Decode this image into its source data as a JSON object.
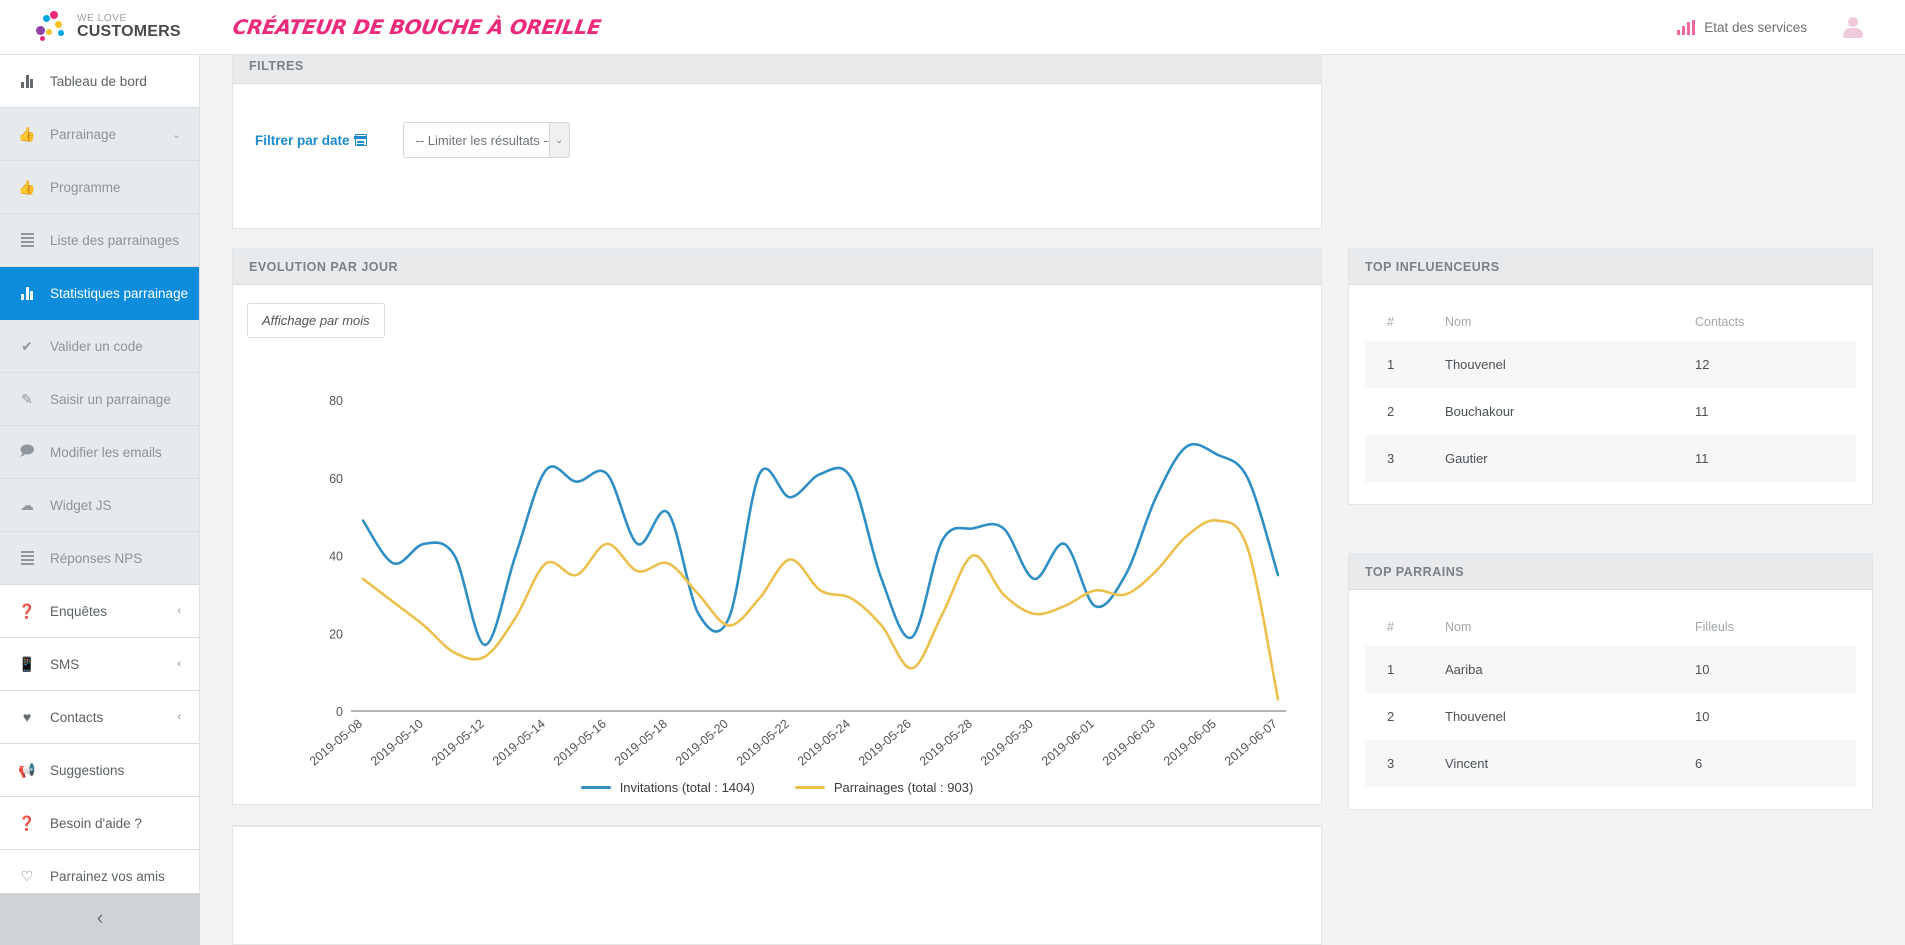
{
  "header": {
    "logo_line1": "WE LOVE",
    "logo_line2": "CUSTOMERS",
    "tagline": "CRÉATEUR DE BOUCHE À OREILLE",
    "services_label": "Etat des services",
    "services_icon": "signal-bars-icon",
    "avatar_icon": "user-avatar-icon",
    "brand_color": "#ec2a7b"
  },
  "sidebar": {
    "collapse_label": "‹",
    "items": [
      {
        "label": "Tableau de bord",
        "icon": "bar-chart-icon",
        "style": "white",
        "caret": ""
      },
      {
        "label": "Parrainage",
        "icon": "thumbs-up-icon",
        "style": "grey",
        "caret": "⌄"
      },
      {
        "label": "Programme",
        "icon": "thumbs-up-icon",
        "style": "grey",
        "caret": ""
      },
      {
        "label": "Liste des parrainages",
        "icon": "list-icon",
        "style": "grey",
        "caret": ""
      },
      {
        "label": "Statistiques parrainage",
        "icon": "bar-chart-icon",
        "style": "active",
        "caret": ""
      },
      {
        "label": "Valider un code",
        "icon": "check-icon",
        "style": "grey",
        "caret": ""
      },
      {
        "label": "Saisir un parrainage",
        "icon": "pencil-icon",
        "style": "grey",
        "caret": ""
      },
      {
        "label": "Modifier les emails",
        "icon": "comment-icon",
        "style": "grey",
        "caret": ""
      },
      {
        "label": "Widget JS",
        "icon": "cloud-icon",
        "style": "grey",
        "caret": ""
      },
      {
        "label": "Réponses NPS",
        "icon": "list-icon",
        "style": "grey",
        "caret": ""
      },
      {
        "label": "Enquêtes",
        "icon": "question-circle-icon",
        "style": "white",
        "caret": "‹"
      },
      {
        "label": "SMS",
        "icon": "mobile-icon",
        "style": "white",
        "caret": "‹"
      },
      {
        "label": "Contacts",
        "icon": "heart-icon",
        "style": "white",
        "caret": "‹"
      },
      {
        "label": "Suggestions",
        "icon": "megaphone-icon",
        "style": "white",
        "caret": ""
      },
      {
        "label": "Besoin d'aide ?",
        "icon": "question-circle-icon",
        "style": "white",
        "caret": ""
      },
      {
        "label": "Parrainez vos amis",
        "icon": "heart-outline-icon",
        "style": "white",
        "caret": ""
      }
    ]
  },
  "filters": {
    "title": "FILTRES",
    "date_filter_label": "Filtrer par date",
    "date_filter_icon": "calendar-icon",
    "limit_select_value": "-- Limiter les résultats --",
    "limit_select_arrow": "⌄"
  },
  "chart_panel": {
    "title": "EVOLUTION PAR JOUR",
    "month_toggle_label": "Affichage par mois"
  },
  "top_influenceurs": {
    "title": "TOP INFLUENCEURS",
    "columns": [
      "#",
      "Nom",
      "Contacts"
    ],
    "rows": [
      {
        "rank": "1",
        "name": "Thouvenel",
        "value": "12"
      },
      {
        "rank": "2",
        "name": "Bouchakour",
        "value": "11"
      },
      {
        "rank": "3",
        "name": "Gautier",
        "value": "11"
      }
    ]
  },
  "top_parrains": {
    "title": "TOP PARRAINS",
    "columns": [
      "#",
      "Nom",
      "Filleuls"
    ],
    "rows": [
      {
        "rank": "1",
        "name": "Aariba",
        "value": "10"
      },
      {
        "rank": "2",
        "name": "Thouvenel",
        "value": "10"
      },
      {
        "rank": "3",
        "name": "Vincent",
        "value": "6"
      }
    ]
  },
  "chart_data": {
    "type": "line",
    "title": "EVOLUTION PAR JOUR",
    "xlabel": "",
    "ylabel": "",
    "ylim": [
      0,
      88
    ],
    "yticks": [
      0,
      20,
      40,
      60,
      80
    ],
    "grid": false,
    "legend_position": "bottom",
    "x": [
      "2019-05-08",
      "2019-05-09",
      "2019-05-10",
      "2019-05-11",
      "2019-05-12",
      "2019-05-13",
      "2019-05-14",
      "2019-05-15",
      "2019-05-16",
      "2019-05-17",
      "2019-05-18",
      "2019-05-19",
      "2019-05-20",
      "2019-05-21",
      "2019-05-22",
      "2019-05-23",
      "2019-05-24",
      "2019-05-25",
      "2019-05-26",
      "2019-05-27",
      "2019-05-28",
      "2019-05-29",
      "2019-05-30",
      "2019-05-31",
      "2019-06-01",
      "2019-06-02",
      "2019-06-03",
      "2019-06-04",
      "2019-06-05",
      "2019-06-06",
      "2019-06-07"
    ],
    "xtick_labels": [
      "2019-05-08",
      "2019-05-10",
      "2019-05-12",
      "2019-05-14",
      "2019-05-16",
      "2019-05-18",
      "2019-05-20",
      "2019-05-22",
      "2019-05-24",
      "2019-05-26",
      "2019-05-28",
      "2019-05-30",
      "2019-06-01",
      "2019-06-03",
      "2019-06-05",
      "2019-06-07"
    ],
    "series": [
      {
        "name": "Invitations (total : 1404)",
        "short_name": "Invitations",
        "total": 1404,
        "color": "#2f8fc4",
        "values": [
          49,
          38,
          43,
          40,
          17,
          40,
          62,
          59,
          61,
          43,
          51,
          25,
          24,
          61,
          55,
          61,
          60,
          34,
          19,
          44,
          47,
          47,
          34,
          43,
          27,
          35,
          55,
          68,
          66,
          60,
          35
        ]
      },
      {
        "name": "Parrainages (total : 903)",
        "short_name": "Parrainages",
        "total": 903,
        "color": "#ecc04d",
        "values": [
          34,
          28,
          22,
          15,
          14,
          24,
          38,
          35,
          43,
          36,
          38,
          30,
          22,
          29,
          39,
          31,
          29,
          22,
          11,
          25,
          40,
          30,
          25,
          27,
          31,
          30,
          36,
          45,
          49,
          42,
          3
        ]
      }
    ]
  }
}
